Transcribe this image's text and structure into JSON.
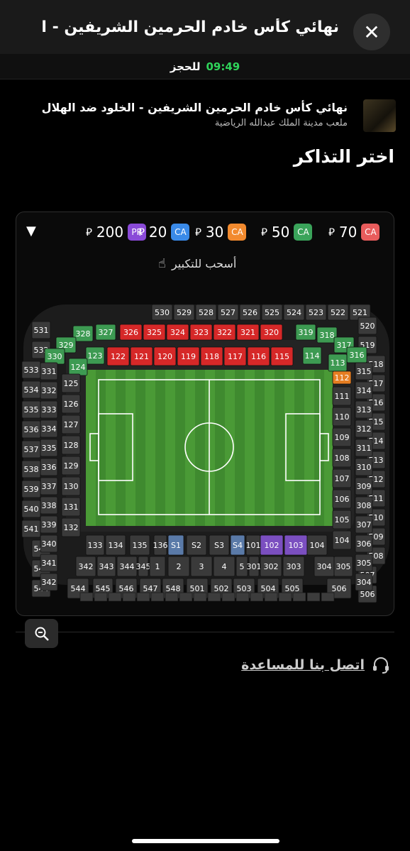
{
  "header": {
    "title": "نهائي كأس خادم الحرمين الشريفين - ال...",
    "close_icon": "close-icon"
  },
  "timer": {
    "time": "09:49",
    "label": "للحجز"
  },
  "event": {
    "name": "نهائي كأس خادم الحرمين الشريفين - الخلود ضد الهلال",
    "venue": "ملعب مدينة الملك عبدالله الرياضية"
  },
  "choose_title": "اختر التذاكر",
  "prices": [
    {
      "code": "CA",
      "amount": "70",
      "currency": "⃁",
      "color": "#e85c5c"
    },
    {
      "code": "CA",
      "amount": "50",
      "currency": "⃁",
      "color": "#3aa35a"
    },
    {
      "code": "CA",
      "amount": "30",
      "currency": "⃁",
      "color": "#f28a2e"
    },
    {
      "code": "CA",
      "amount": "20",
      "currency": "⃁",
      "color": "#3a8ae8"
    },
    {
      "code": "PR",
      "amount": "200",
      "currency": "⃁",
      "color": "#8a4ad8"
    }
  ],
  "drag_hint": "أسحب للتكبير",
  "stadium": {
    "red": [
      "320",
      "321",
      "322",
      "323",
      "324",
      "325",
      "326",
      "115",
      "116",
      "117",
      "118",
      "119",
      "120",
      "121",
      "122"
    ],
    "green": [
      "319",
      "318",
      "317",
      "316",
      "114",
      "113",
      "327",
      "328",
      "329",
      "330",
      "123",
      "124"
    ],
    "orange": [
      "112"
    ],
    "purple": [
      "102",
      "103"
    ],
    "blue": [
      "S1",
      "S4"
    ],
    "upper_top": [
      "521",
      "522",
      "523",
      "524",
      "525",
      "526",
      "527",
      "528",
      "529",
      "530"
    ],
    "upper_left": [
      "531",
      "532",
      "533",
      "534",
      "535",
      "536",
      "537",
      "538",
      "539",
      "540",
      "541",
      "542",
      "543",
      "544"
    ],
    "upper_right": [
      "520",
      "519",
      "518",
      "517",
      "516",
      "515",
      "514",
      "513",
      "512",
      "511",
      "510",
      "509",
      "508",
      "507",
      "506"
    ],
    "middle_left": [
      "331",
      "332",
      "333",
      "334",
      "335",
      "336",
      "337",
      "338",
      "339",
      "340",
      "341",
      "342"
    ],
    "middle_right": [
      "315",
      "314",
      "313",
      "312",
      "311",
      "310",
      "309",
      "308",
      "307",
      "306",
      "305",
      "304"
    ],
    "lower_left": [
      "125",
      "126",
      "127",
      "128",
      "129",
      "130",
      "131",
      "132"
    ],
    "lower_right": [
      "111",
      "110",
      "109",
      "108",
      "107",
      "106",
      "105",
      "104"
    ],
    "bottom_lower": [
      "133",
      "134",
      "135",
      "136",
      "S1",
      "S2",
      "S3",
      "S4",
      "101",
      "102",
      "103"
    ],
    "bottom_middle": [
      "343",
      "344",
      "345",
      "1",
      "2",
      "3",
      "4",
      "5",
      "301",
      "302",
      "303"
    ],
    "bottom_upper": [
      "545",
      "546",
      "547",
      "548",
      "501",
      "502",
      "503",
      "504",
      "505"
    ]
  },
  "help_label": "اتصل بنا للمساعدة",
  "colors": {
    "green_time": "#2fd35a",
    "red": "#d62828",
    "green": "#3d9a52",
    "orange": "#e67e22",
    "purple": "#7b4fc0",
    "blue": "#5a7aa8",
    "dark_seat": "#3a3a3a"
  }
}
